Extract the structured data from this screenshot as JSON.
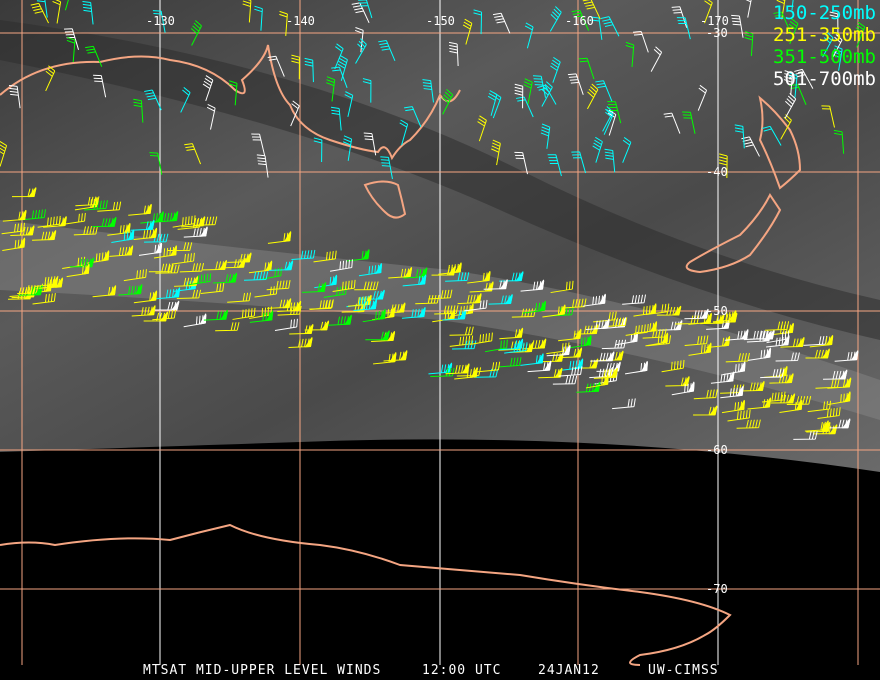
{
  "title": "MTSAT MID-UPPER LEVEL WINDS",
  "caption": {
    "product": "MTSAT MID-UPPER LEVEL WINDS",
    "time": "12:00 UTC",
    "date": "24JAN12",
    "source": "UW-CIMSS"
  },
  "legend": [
    {
      "label": "150-250mb",
      "color": "#00ffff"
    },
    {
      "label": "251-350mb",
      "color": "#ffff00"
    },
    {
      "label": "351-500mb",
      "color": "#00ff00"
    },
    {
      "label": "501-700mb",
      "color": "#ffffff"
    }
  ],
  "longitude_labels": [
    "-130",
    "-140",
    "-150",
    "-160",
    "-170"
  ],
  "latitude_labels": [
    "-30",
    "-40",
    "-50",
    "-60",
    "-70"
  ],
  "colors": {
    "coastline": "#f4a582",
    "grid_orange": "#f4a582",
    "grid_white": "#ffffff"
  }
}
